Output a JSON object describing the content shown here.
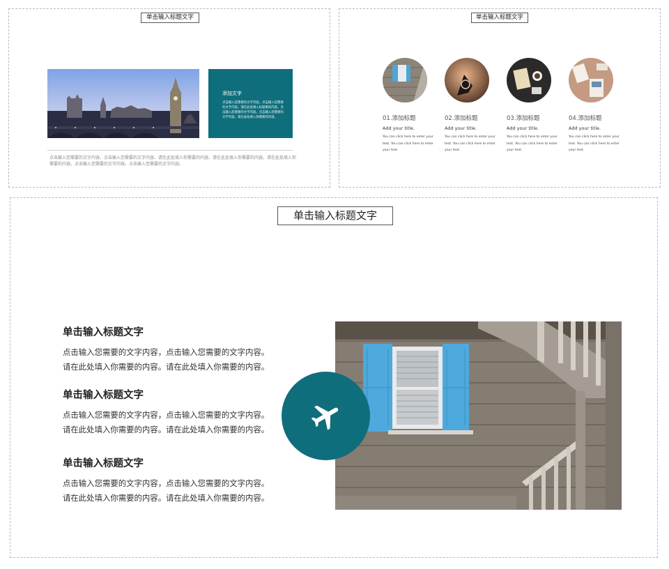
{
  "colors": {
    "accent": "#0f6e7c",
    "border": "#b9b9b9"
  },
  "slide1": {
    "title": "单击输入标题文字",
    "card_heading": "添加文字",
    "card_body": "点击输入您需要的文字内容。点击输入您需要的文字内容。请在此处填入标题要的内容。点击输入您需要的文字内容。点击输入您需要的文字内容。请在此处填入你需要的内容。",
    "description": "点击输入您需要的文字内容。点击输入您需要的文字内容。请在此处填入你需要的内容。请在此处填入你需要的内容。请在此处填入你需要的内容。点击输入您需要的文字内容。点击输入您需要的文字内容。"
  },
  "slide2": {
    "title": "单击输入标题文字",
    "items": [
      {
        "title": "01.添加标题",
        "subtitle": "Add your title.",
        "body": "You can click here to enter your text. You can click here to enter your text."
      },
      {
        "title": "02.添加标题",
        "subtitle": "Add your title.",
        "body": "You can click here to enter your text. You can click here to enter your text."
      },
      {
        "title": "03.添加标题",
        "subtitle": "Add your title.",
        "body": "You can click here to enter your text. You can click here to enter your text."
      },
      {
        "title": "04.添加标题",
        "subtitle": "Add your title.",
        "body": "You can click here to enter your text. You can click here to enter your text."
      }
    ]
  },
  "slide3": {
    "title": "单击输入标题文字",
    "sections": [
      {
        "heading": "单击输入标题文字",
        "line1": "点击输入您需要的文字内容，点击输入您需要的文字内容。",
        "line2": "请在此处填入你需要的内容。请在此处填入你需要的内容。"
      },
      {
        "heading": "单击输入标题文字",
        "line1": "点击输入您需要的文字内容，点击输入您需要的文字内容。",
        "line2": "请在此处填入你需要的内容。请在此处填入你需要的内容。"
      },
      {
        "heading": "单击输入标题文字",
        "line1": "点击输入您需要的文字内容，点击输入您需要的文字内容。",
        "line2": "请在此处填入你需要的内容。请在此处填入你需要的内容。"
      }
    ],
    "badge_icon": "airplane-icon"
  }
}
